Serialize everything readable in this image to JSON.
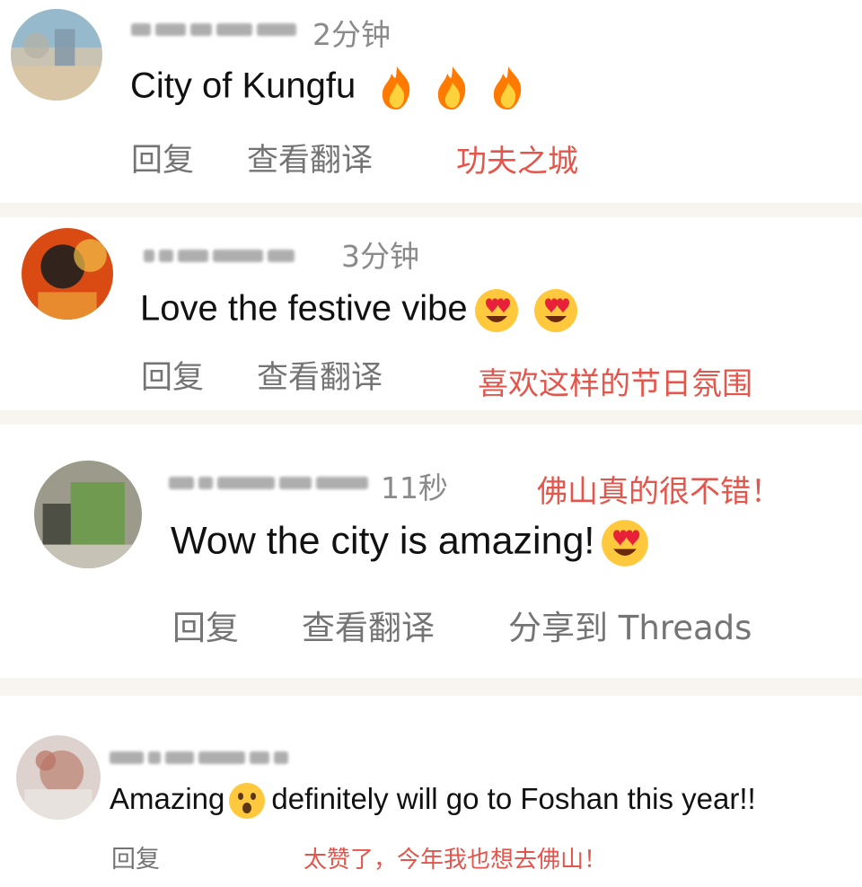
{
  "accent_colors": {
    "translation": "#e4564c",
    "meta": "#8a8a8a",
    "action": "#747474",
    "divider": "#f8f5f1"
  },
  "comments": [
    {
      "time": "2分钟",
      "text": "City of Kungfu",
      "emojis": [
        "fire-emoji",
        "fire-emoji",
        "fire-emoji"
      ],
      "reply": "回复",
      "translate": "查看翻译",
      "translation": "功夫之城"
    },
    {
      "time": "3分钟",
      "text": "Love the festive vibe",
      "emojis": [
        "heart-eyes-emoji",
        "heart-eyes-emoji"
      ],
      "reply": "回复",
      "translate": "查看翻译",
      "translation": "喜欢这样的节日氛围"
    },
    {
      "time": "11秒",
      "text": "Wow the city is amazing!",
      "emojis": [
        "heart-eyes-emoji"
      ],
      "reply": "回复",
      "translate": "查看翻译",
      "share": "分享到 Threads",
      "translation": "佛山真的很不错！"
    },
    {
      "time": "",
      "text_before": "Amazing",
      "text_after": "definitely will go to Foshan this year!!",
      "emojis": [
        "surprised-emoji"
      ],
      "reply": "回复",
      "translation": "太赞了，今年我也想去佛山！"
    }
  ]
}
